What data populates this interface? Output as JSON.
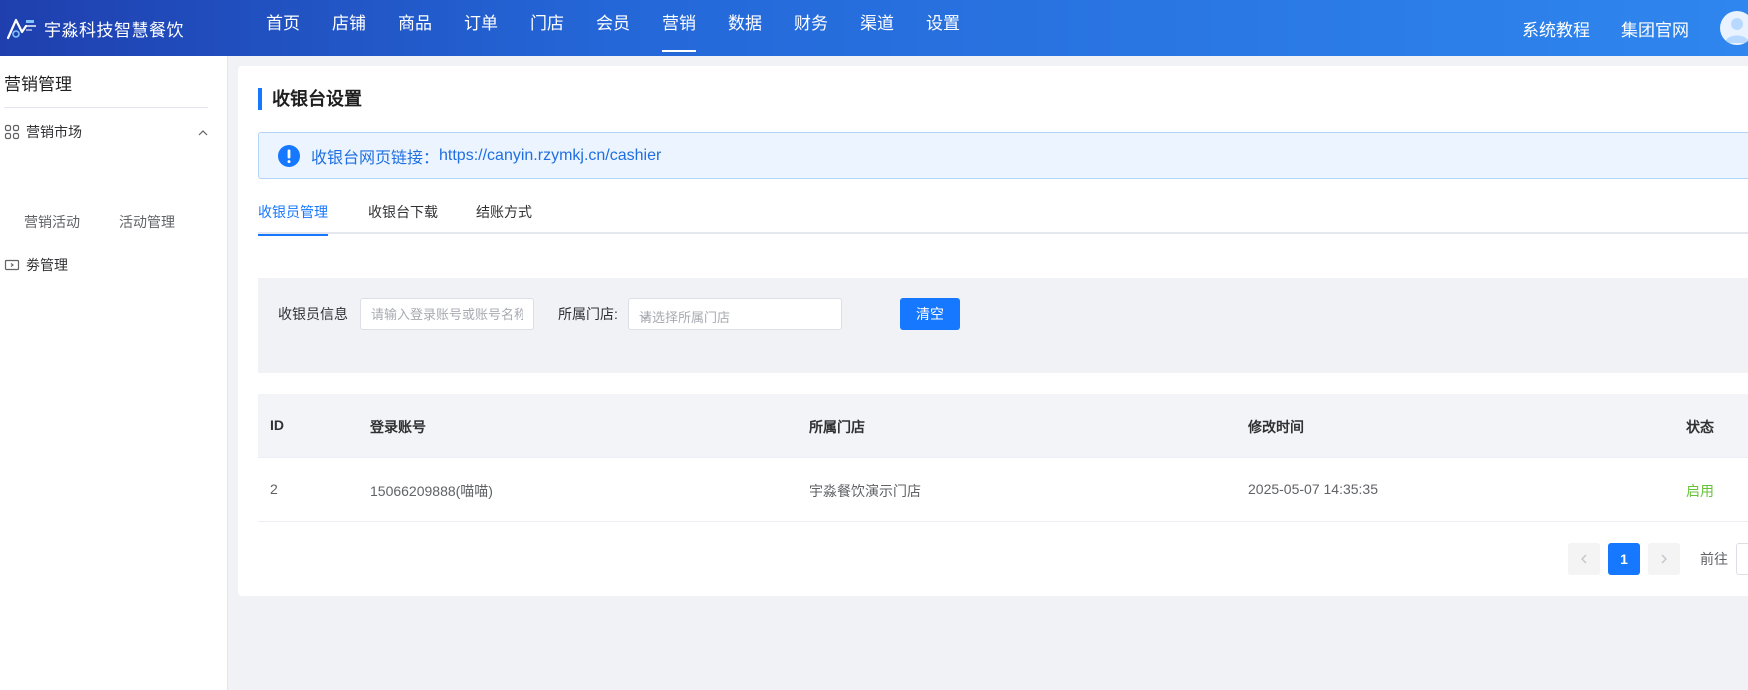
{
  "header": {
    "brand": "宇淼科技智慧餐饮",
    "nav": [
      "首页",
      "店铺",
      "商品",
      "订单",
      "门店",
      "会员",
      "营销",
      "数据",
      "财务",
      "渠道",
      "设置"
    ],
    "active_nav": "营销",
    "links": [
      "系统教程",
      "集团官网"
    ]
  },
  "sidebar": {
    "title": "营销管理",
    "group1": "营销市场",
    "group1_items": [
      "营销活动",
      "活动管理"
    ],
    "group2": "劵管理"
  },
  "page": {
    "title": "收银台设置",
    "alert_label": "收银台网页链接：",
    "alert_url": "https://canyin.rzymkj.cn/cashier"
  },
  "tabs": [
    "收银员管理",
    "收银台下载",
    "结账方式"
  ],
  "filter": {
    "cashier_label": "收银员信息",
    "cashier_placeholder": "请输入登录账号或账号名称",
    "store_label": "所属门店:",
    "store_placeholder": "请选择所属门店",
    "clear_button": "清空"
  },
  "table": {
    "headers": [
      "ID",
      "登录账号",
      "所属门店",
      "修改时间",
      "状态"
    ],
    "rows": [
      [
        "2",
        "15066209888(喵喵)",
        "宇淼餐饮演示门店",
        "2025-05-07 14:35:35",
        "启用"
      ]
    ]
  },
  "pagination": {
    "current": "1",
    "goto_label": "前往"
  },
  "colors": {
    "accent": "#1677ff",
    "status_enabled": "#67c23a"
  }
}
